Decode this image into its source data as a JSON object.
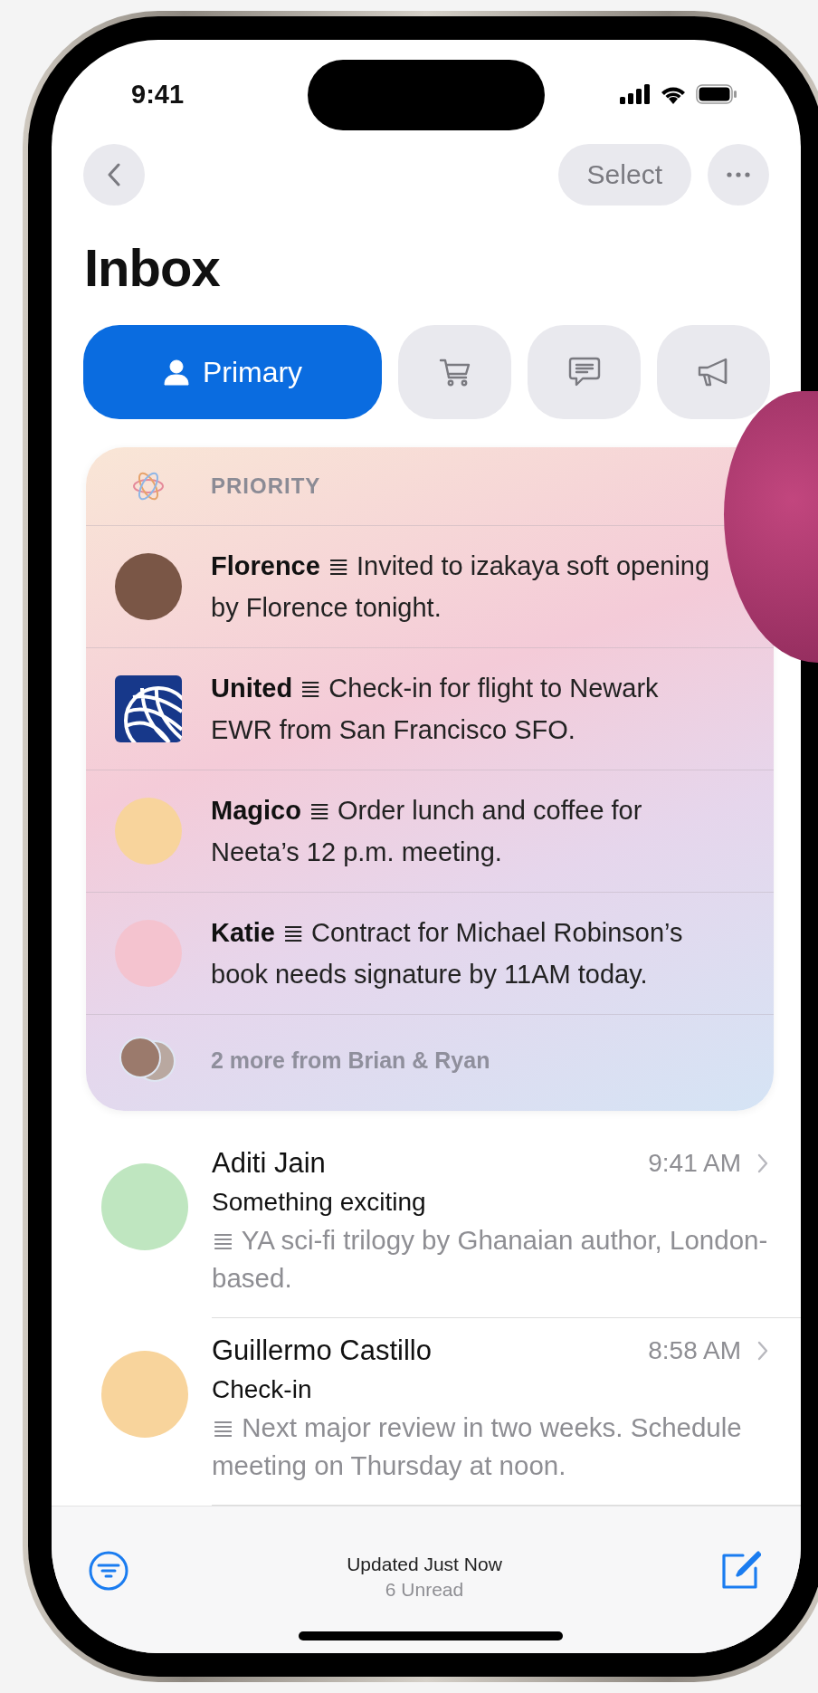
{
  "status_bar": {
    "time": "9:41"
  },
  "nav": {
    "select": "Select"
  },
  "title": "Inbox",
  "tabs": [
    {
      "kind": "person",
      "label": "Primary",
      "selected": true
    },
    {
      "kind": "cart",
      "selected": false
    },
    {
      "kind": "chat",
      "selected": false
    },
    {
      "kind": "megaphone",
      "selected": false
    }
  ],
  "priority": {
    "heading": "PRIORITY",
    "items": [
      {
        "kind": "photo",
        "color": "#7a5646",
        "text": "**Florence** ≣ Invited to izakaya soft opening by Florence tonight."
      },
      {
        "kind": "logo",
        "color": "#17388a",
        "text": "**United** ≣ Check-in for flight to Newark EWR from San Francisco SFO."
      },
      {
        "kind": "memoji",
        "color": "#f8d49c",
        "text": "**Magico** ≣ Order lunch and coffee for Neeta’s 12 p.m. meeting."
      },
      {
        "kind": "memoji",
        "color": "#f4c3cf",
        "text": "**Katie** ≣ Contract for Michael Robinson’s book needs signature by 11AM today."
      }
    ],
    "more": "2 more from Brian & Ryan"
  },
  "messages": [
    {
      "sender": "Aditi Jain",
      "time": "9:41 AM",
      "subject": "Something exciting",
      "summary": "≣ YA sci-fi trilogy by Ghanaian author, London-based.",
      "color": "#bfe6c0"
    },
    {
      "sender": "Guillermo Castillo",
      "time": "8:58 AM",
      "subject": "Check-in",
      "summary": "≣ Next major review in two weeks. Schedule meeting on Thursday at noon.",
      "color": "#f8d49c"
    }
  ],
  "toolbar": {
    "status": "Updated Just Now",
    "unread": "6 Unread"
  }
}
